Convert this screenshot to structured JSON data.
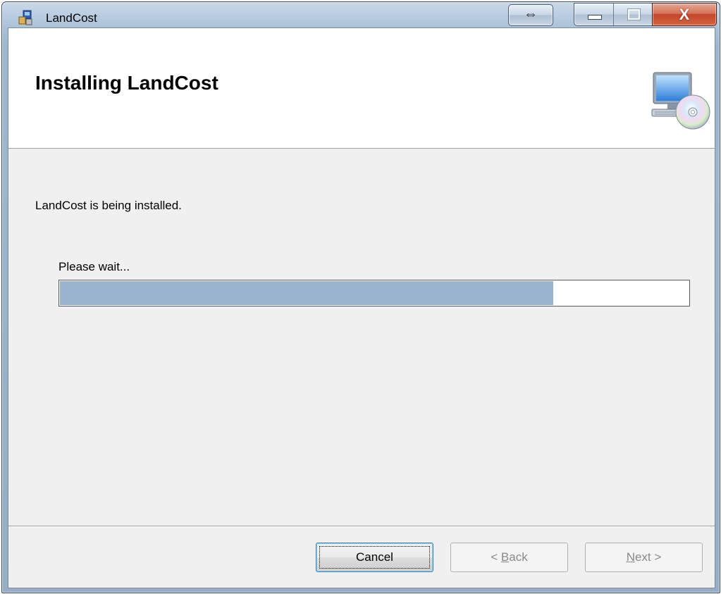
{
  "window": {
    "title": "LandCost"
  },
  "caption_buttons": {
    "resize_glyph": "⇔",
    "close_glyph": "X"
  },
  "header": {
    "title": "Installing LandCost",
    "icon": "computer-cd-icon"
  },
  "body": {
    "status_text": "LandCost is being installed.",
    "wait_label": "Please wait...",
    "progress_fraction": 0.785
  },
  "buttons": {
    "cancel": "Cancel",
    "back_prefix": "< ",
    "back_access": "B",
    "back_rest": "ack",
    "next_access": "N",
    "next_rest": "ext >"
  },
  "colors": {
    "progress_fill": "#9ab3cf",
    "close_button": "#c5462b"
  }
}
